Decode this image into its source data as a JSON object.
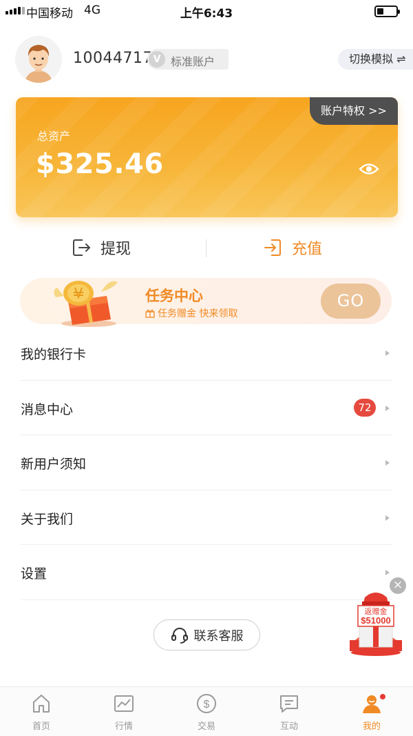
{
  "status_bar": {
    "carrier": "中国移动",
    "network": "4G",
    "time": "上午6:43"
  },
  "profile": {
    "user_id": "10044717",
    "account_badge_icon": "V",
    "account_type": "标准账户",
    "switch_label": "切换模拟 ⇌"
  },
  "asset_card": {
    "privilege_label": "账户特权 >>",
    "total_label": "总资产",
    "total_value": "$325.46"
  },
  "actions": {
    "withdraw": "提现",
    "deposit": "充值"
  },
  "task_banner": {
    "title": "任务中心",
    "subtitle": "任务赠金 快来领取",
    "button": "GO"
  },
  "menu": [
    {
      "label": "我的银行卡"
    },
    {
      "label": "消息中心",
      "badge": "72"
    },
    {
      "label": "新用户须知"
    },
    {
      "label": "关于我们"
    },
    {
      "label": "设置"
    }
  ],
  "service_button": "联系客服",
  "promo": {
    "line1": "返赠金",
    "line2": "$51000",
    "close": "×"
  },
  "tabs": [
    {
      "label": "首页",
      "icon": "home-icon"
    },
    {
      "label": "行情",
      "icon": "market-icon"
    },
    {
      "label": "交易",
      "icon": "trade-icon"
    },
    {
      "label": "互动",
      "icon": "chat-icon"
    },
    {
      "label": "我的",
      "icon": "user-icon"
    }
  ],
  "colors": {
    "accent": "#f08a24",
    "card": "#f7a51f",
    "badge": "#e64a3f"
  }
}
